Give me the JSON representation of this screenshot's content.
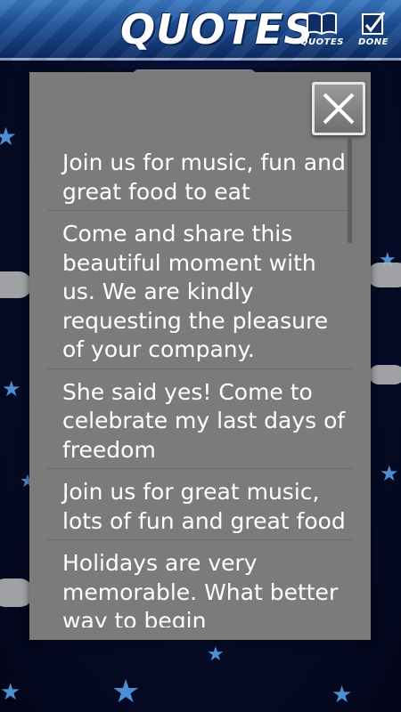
{
  "header": {
    "title": "QUOTES",
    "quotes_label": "QUOTES",
    "done_label": "DONE"
  },
  "dialog": {
    "items": [
      "Join us for music, fun and great food to eat",
      "Come and share this beautiful moment with us. We are kindly requesting the pleasure of your company.",
      "She said yes! Come to celebrate my last days of freedom",
      "Join us for great music, lots of fun and great food",
      "Holidays are very memorable. What better way to begin"
    ]
  },
  "colors": {
    "header": "#1c4e95",
    "dialog": "#7b7b7b",
    "background": "#050a22",
    "star": "#4f8fd1"
  },
  "icons": [
    "star-icon",
    "book-icon",
    "checkbox-icon",
    "close-icon"
  ]
}
